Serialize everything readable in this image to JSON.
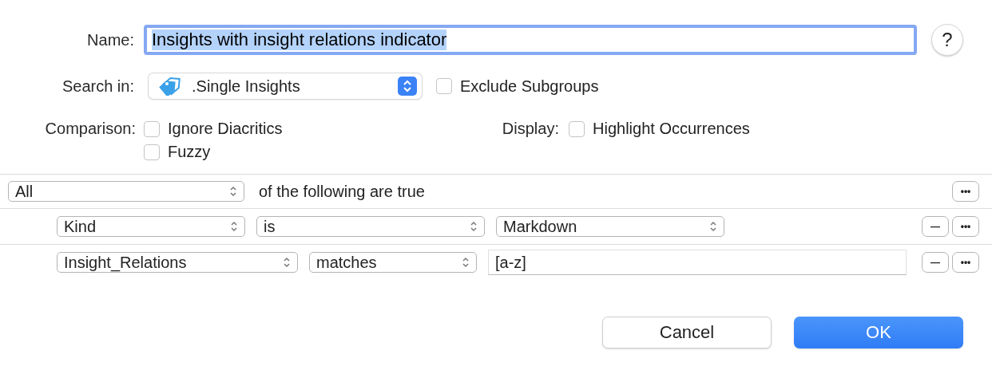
{
  "name_field": {
    "label": "Name:",
    "value": "Insights with insight relations indicator",
    "focused": true,
    "text_selected": true
  },
  "help_button": {
    "label": "?"
  },
  "search_in": {
    "label": "Search in:",
    "value": ".Single Insights"
  },
  "exclude_subgroups": {
    "label": "Exclude Subgroups",
    "checked": false
  },
  "comparison": {
    "label": "Comparison:",
    "options": [
      {
        "label": "Ignore Diacritics",
        "checked": false
      },
      {
        "label": "Fuzzy",
        "checked": false
      }
    ]
  },
  "display": {
    "label": "Display:",
    "options": [
      {
        "label": "Highlight Occurrences",
        "checked": false
      }
    ]
  },
  "match_rule": {
    "value": "All",
    "text": "of the following are true",
    "more_button": "•••"
  },
  "criteria": [
    {
      "parts": [
        {
          "kind": "popup",
          "value": "Kind"
        },
        {
          "kind": "popup",
          "value": "is"
        },
        {
          "kind": "popup",
          "value": "Markdown"
        }
      ],
      "remove_button": "—",
      "more_button": "•••"
    },
    {
      "parts": [
        {
          "kind": "popup",
          "value": "Insight_Relations"
        },
        {
          "kind": "popup",
          "value": "matches"
        },
        {
          "kind": "field",
          "value": "[a-z]"
        }
      ],
      "remove_button": "—",
      "more_button": "•••"
    }
  ],
  "buttons": [
    {
      "label": "Cancel",
      "default": false
    },
    {
      "label": "OK",
      "default": true
    }
  ]
}
